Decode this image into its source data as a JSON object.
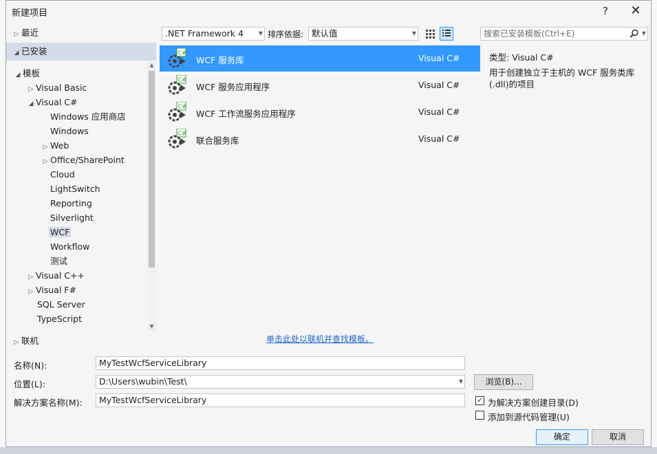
{
  "window": {
    "title": "新建项目",
    "help_label": "?",
    "close_label": "✕"
  },
  "tree": {
    "recent": "最近",
    "installed": "已安装",
    "templates": "模板",
    "visual_basic": "Visual Basic",
    "visual_csharp": "Visual C#",
    "windows_store": "Windows 应用商店",
    "windows": "Windows",
    "web": "Web",
    "office_sharepoint": "Office/SharePoint",
    "cloud": "Cloud",
    "lightswitch": "LightSwitch",
    "reporting": "Reporting",
    "silverlight": "Silverlight",
    "wcf": "WCF",
    "workflow": "Workflow",
    "test": "测试",
    "visual_cpp": "Visual C++",
    "visual_fsharp": "Visual F#",
    "sql_server": "SQL Server",
    "typescript": "TypeScript",
    "online": "联机"
  },
  "toolbar": {
    "framework": ".NET Framework 4",
    "sort_label": "排序依据:",
    "sort_value": "默认值",
    "search_placeholder": "搜索已安装模板(Ctrl+E)"
  },
  "templates": [
    {
      "name": "WCF 服务库",
      "lang": "Visual C#"
    },
    {
      "name": "WCF 服务应用程序",
      "lang": "Visual C#"
    },
    {
      "name": "WCF 工作流服务应用程序",
      "lang": "Visual C#"
    },
    {
      "name": "联合服务库",
      "lang": "Visual C#"
    }
  ],
  "online_link": "单击此处以联机并查找模板。",
  "description": {
    "type_label": "类型:",
    "type_value": "Visual C#",
    "text": "用于创建独立于主机的 WCF 服务类库(.dll)的项目"
  },
  "form": {
    "name_label": "名称(N):",
    "name_value": "MyTestWcfServiceLibrary",
    "location_label": "位置(L):",
    "location_value": "D:\\Users\\wubin\\Test\\",
    "solution_label": "解决方案名称(M):",
    "solution_value": "MyTestWcfServiceLibrary",
    "browse_label": "浏览(B)...",
    "create_dir_label": "为解决方案创建目录(D)",
    "add_source_label": "添加到源代码管理(U)",
    "ok_label": "确定",
    "cancel_label": "取消"
  },
  "colors": {
    "selection": "#3399ff",
    "tree_selection": "#d6dbe9",
    "link": "#1e64c8",
    "icon_green": "#3f9c35"
  }
}
